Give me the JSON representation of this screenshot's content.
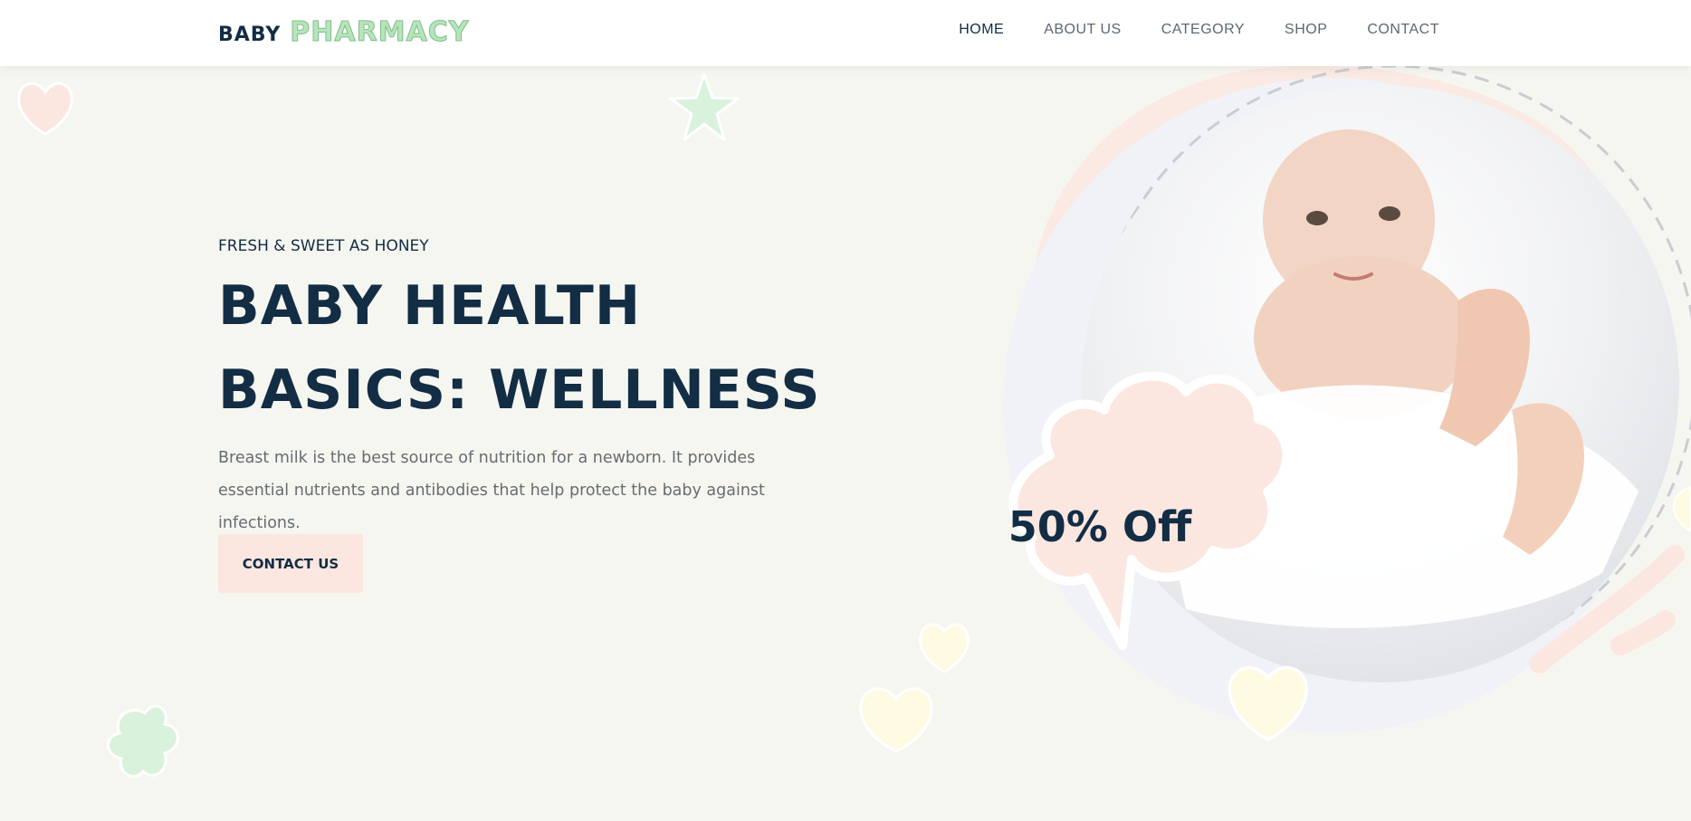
{
  "header": {
    "logo": {
      "word1": "BABY",
      "word2": "PHARMACY"
    },
    "nav": [
      {
        "label": "HOME",
        "active": true
      },
      {
        "label": "ABOUT US",
        "active": false
      },
      {
        "label": "CATEGORY",
        "active": false
      },
      {
        "label": "SHOP",
        "active": false
      },
      {
        "label": "CONTACT",
        "active": false
      }
    ]
  },
  "hero": {
    "eyebrow": "FRESH & SWEET AS HONEY",
    "headline_line1": "BABY HEALTH",
    "headline_line2": "BASICS: WELLNESS",
    "description": "Breast milk is the best source of nutrition for a newborn. It provides essential nutrients and antibodies that help protect the baby against infections.",
    "cta_label": "CONTACT US",
    "offer_badge": "50% Off"
  },
  "colors": {
    "navy": "#122d44",
    "background": "#f6f6f1",
    "peach": "#fbe7e0",
    "mint": "#d9f2dc",
    "butter": "#fffbe2"
  }
}
